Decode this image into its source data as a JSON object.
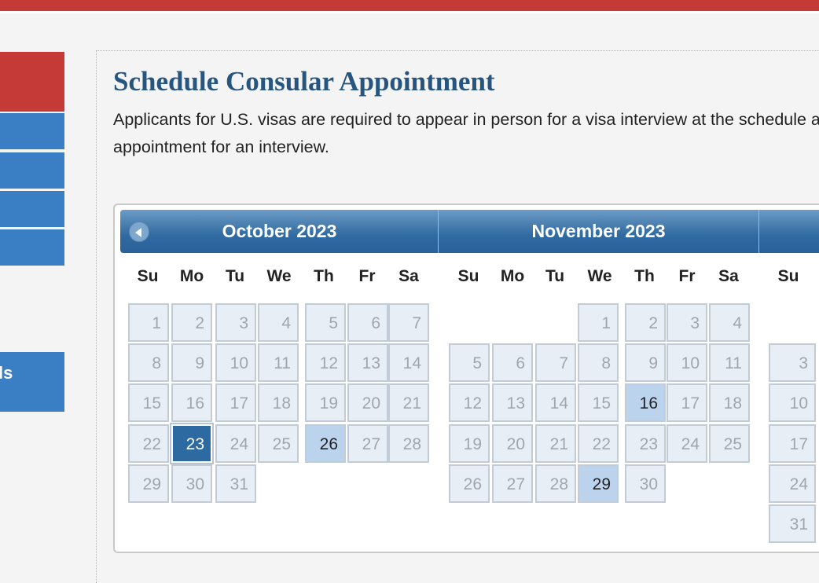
{
  "colors": {
    "brand_red": "#c53a36",
    "nav_blue": "#3a7fc4",
    "header_blue": "#2f6aa0",
    "selected": "#2c6aa1",
    "highlight": "#bcd3ee"
  },
  "sidebar": {
    "partial_label": "ls"
  },
  "page": {
    "title": "Schedule Consular Appointment",
    "intro": "Applicants for U.S. visas are required to appear in person for a visa interview at the schedule an appointment for an interview."
  },
  "datepicker": {
    "prev_icon": "chevron-left-icon",
    "months": [
      {
        "title": "October 2023"
      },
      {
        "title": "November 2023"
      },
      {
        "title": ""
      }
    ],
    "weekdays": [
      "Su",
      "Mo",
      "Tu",
      "We",
      "Th",
      "Fr",
      "Sa"
    ],
    "october": [
      "1",
      "2",
      "3",
      "4",
      "5",
      "6",
      "7",
      "8",
      "9",
      "10",
      "11",
      "12",
      "13",
      "14",
      "15",
      "16",
      "17",
      "18",
      "19",
      "20",
      "21",
      "22",
      "23",
      "24",
      "25",
      "26",
      "27",
      "28",
      "29",
      "30",
      "31"
    ],
    "november": [
      "1",
      "2",
      "3",
      "4",
      "5",
      "6",
      "7",
      "8",
      "9",
      "10",
      "11",
      "12",
      "13",
      "14",
      "15",
      "16",
      "17",
      "18",
      "19",
      "20",
      "21",
      "22",
      "23",
      "24",
      "25",
      "26",
      "27",
      "28",
      "29",
      "30"
    ],
    "december_partial": [
      "3",
      "10",
      "17",
      "24",
      "31"
    ],
    "selected_day": "23",
    "available_days": [
      "October 26",
      "November 16",
      "November 29"
    ]
  }
}
